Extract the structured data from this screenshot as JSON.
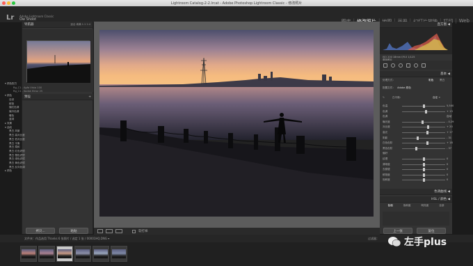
{
  "window": {
    "title": "Lightroom Catalog-2-2.lrcat - Adobe Photoshop Lightroom Classic - 修改照片"
  },
  "identity": {
    "logo": "Lr",
    "line1": "Adobe Lightroom Classic",
    "user": "Ow Shoot"
  },
  "modules": [
    "图库",
    "修改照片",
    "地图",
    "画册",
    "幻灯片放映",
    "打印",
    "Web"
  ],
  "active_module": "修改照片",
  "left": {
    "navigator": {
      "title": "导航器",
      "zoom": "适合  填满  1:1  1:4"
    },
    "presets": {
      "title": "预设",
      "items": [
        {
          "label": "▾ 颜色配方",
          "level": 0
        },
        {
          "label": "Rg_C1 - Agfa Vista 100",
          "level": 2
        },
        {
          "label": "Rg_C1 - Kodak Ektar 25",
          "level": 2
        },
        {
          "label": "▾ 颜色",
          "level": 0
        },
        {
          "label": "自然",
          "level": 1
        },
        {
          "label": "鲜艳",
          "level": 1
        },
        {
          "label": "偏红色调",
          "level": 1
        },
        {
          "label": "偏冷色调",
          "level": 1
        },
        {
          "label": "暖色",
          "level": 1
        },
        {
          "label": "蓝绿",
          "level": 1
        },
        {
          "label": "▸ 效果",
          "level": 0
        },
        {
          "label": "▾ 曲线",
          "level": 0
        },
        {
          "label": "黑白 风景",
          "level": 1
        },
        {
          "label": "黑白 高对比度",
          "level": 1
        },
        {
          "label": "黑白 低对比度",
          "level": 1
        },
        {
          "label": "黑白 平衡",
          "level": 1
        },
        {
          "label": "黑白 柔和",
          "level": 1
        },
        {
          "label": "黑白 红色滤镜",
          "level": 1
        },
        {
          "label": "黑白 橙色滤镜",
          "level": 1
        },
        {
          "label": "黑白 绿色滤镜",
          "level": 1
        },
        {
          "label": "黑白 黄色滤镜",
          "level": 1
        },
        {
          "label": "黑白 反向色调",
          "level": 1
        }
      ],
      "more": "▸ 颜色"
    },
    "buttons": [
      "拷贝...",
      "粘贴"
    ]
  },
  "right": {
    "histogram_title": "直方图 ◀",
    "histogram_info": "ISO 200  18mm  f/9.0  1/125",
    "original": "原始照片",
    "basic_title": "基本 ◀",
    "treatment": {
      "label": "处理方式：",
      "color": "彩色",
      "bw": "黑白"
    },
    "profile": {
      "label": "配置文件：",
      "value": "Adobe 颜色"
    },
    "wb": {
      "label": "白平衡：",
      "value": "自定 ÷"
    },
    "sliders": [
      {
        "label": "色温",
        "value": "5,500",
        "pos": 0.5
      },
      {
        "label": "色调",
        "value": "+ 13",
        "pos": 0.55
      },
      {
        "label": "色调",
        "value": "自动",
        "pos": -1
      },
      {
        "label": "曝光度",
        "value": "- 0.29",
        "pos": 0.46
      },
      {
        "label": "对比度",
        "value": "+ 20",
        "pos": 0.6
      },
      {
        "label": "高光",
        "value": "+ 17",
        "pos": 0.58
      },
      {
        "label": "阴影",
        "value": "- 31",
        "pos": 0.35
      },
      {
        "label": "白色色阶",
        "value": "+ 18",
        "pos": 0.59
      },
      {
        "label": "黑色色阶",
        "value": "- 37",
        "pos": 0.32
      },
      {
        "label": "偏好",
        "value": "",
        "pos": -1
      },
      {
        "label": "纹理",
        "value": "0",
        "pos": 0.5
      },
      {
        "label": "清晰度",
        "value": "0",
        "pos": 0.5
      },
      {
        "label": "去朦胧",
        "value": "0",
        "pos": 0.5
      },
      {
        "label": "鲜艳度",
        "value": "0",
        "pos": 0.5
      },
      {
        "label": "饱和度",
        "value": "0",
        "pos": 0.5
      }
    ],
    "tone_curve": "色调曲线 ◀",
    "hsl": "HSL / 颜色 ◀",
    "hsl_tabs": [
      "色相",
      "饱和度",
      "明亮度",
      "全部"
    ],
    "buttons": [
      "上一张",
      "复位"
    ]
  },
  "toolbar": {
    "softproof": "软打样"
  },
  "filmstrip": {
    "path": "文件夹：作品选用 Thanks  6 张照片 / 选定 1 张 / 00001HQ.DNG ▾",
    "filter": "过滤器：",
    "thumbs": 6,
    "selected_index": 2
  },
  "watermark": {
    "text": "左手plus"
  }
}
